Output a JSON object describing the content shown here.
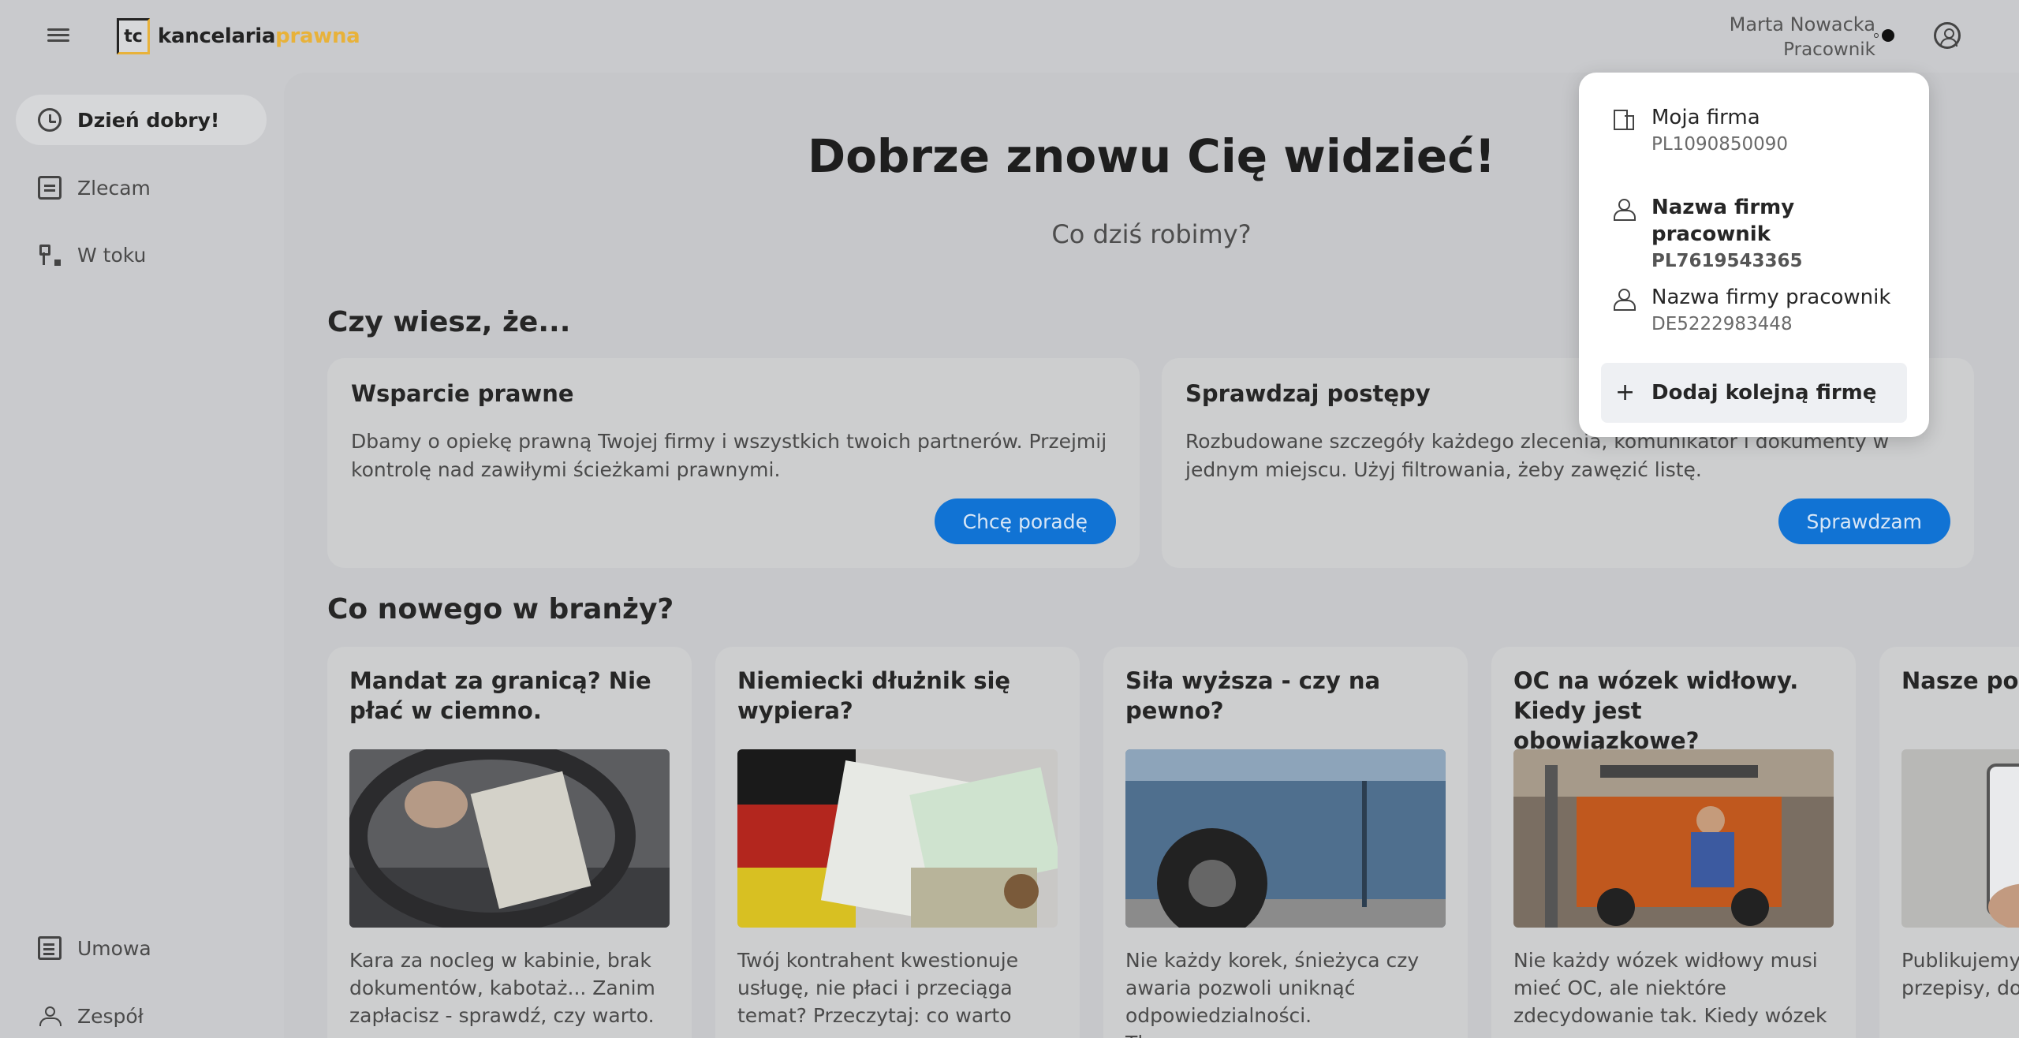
{
  "header": {
    "logo_mark": "tc",
    "logo_text": "kancelaria",
    "logo_accent": "prawna",
    "user_name": "Marta Nowacka",
    "user_role": "Pracownik"
  },
  "sidebar": {
    "items": [
      {
        "label": "Dzień dobry!",
        "icon": "clock-icon",
        "active": true
      },
      {
        "label": "Zlecam",
        "icon": "document-icon"
      },
      {
        "label": "W toku",
        "icon": "flow-icon"
      },
      {
        "label": "Umowa",
        "icon": "contract-icon"
      },
      {
        "label": "Zespół",
        "icon": "team-icon"
      }
    ]
  },
  "hero": {
    "title": "Dobrze znowu Cię widzieć!",
    "subtitle": "Co dziś robimy?"
  },
  "tips": {
    "title": "Czy wiesz, że...",
    "cards": [
      {
        "title": "Wsparcie prawne",
        "text": "Dbamy o opiekę prawną Twojej firmy i wszystkich twoich partnerów. Przejmij kontrolę nad zawiłymi ścieżkami prawnymi.",
        "button": "Chcę poradę"
      },
      {
        "title": "Sprawdzaj postępy",
        "text": "Rozbudowane szczegóły każdego zlecenia, komunikator i dokumenty w jednym miejscu. Użyj filtrowania, żeby zawęzić listę.",
        "button": "Sprawdzam"
      }
    ]
  },
  "news": {
    "title": "Co nowego w branży?",
    "cards": [
      {
        "title": "Mandat za granicą? Nie płać w ciemno.",
        "text": "Kara za nocleg w kabinie, brak dokumentów, kabotaż... Zanim zapłacisz - sprawdź, czy warto."
      },
      {
        "title": "Niemiecki dłużnik się wypiera?",
        "text": "Twój kontrahent kwestionuje usługę, nie płaci i przeciąga temat? Przeczytaj: co warto"
      },
      {
        "title": "Siła wyższa - czy na pewno?",
        "text": "Nie każdy korek, śnieżyca czy awaria pozwoli uniknąć odpowiedzialności. Tłumaczymy,"
      },
      {
        "title": "OC na wózek widłowy. Kiedy jest obowiązkowe?",
        "text": "Nie każdy wózek widłowy musi mieć OC, ale niektóre zdecydowanie tak. Kiedy wózek"
      },
      {
        "title": "Nasze pod z LinkedIn",
        "text": "Publikujemy firm transpo przepisy, dob"
      }
    ]
  },
  "company_dropdown": {
    "items": [
      {
        "name": "Moja firma",
        "nip": "PL1090850090",
        "icon": "building-icon"
      },
      {
        "name": "Nazwa firmy pracownik",
        "nip": "PL7619543365",
        "icon": "person-icon",
        "selected": true
      },
      {
        "name": "Nazwa firmy pracownik",
        "nip": "DE5222983448",
        "icon": "person-icon"
      }
    ],
    "add_label": "Dodaj kolejną firmę"
  },
  "colors": {
    "accent_blue": "#1173d4",
    "logo_yellow": "#e8b23a"
  }
}
